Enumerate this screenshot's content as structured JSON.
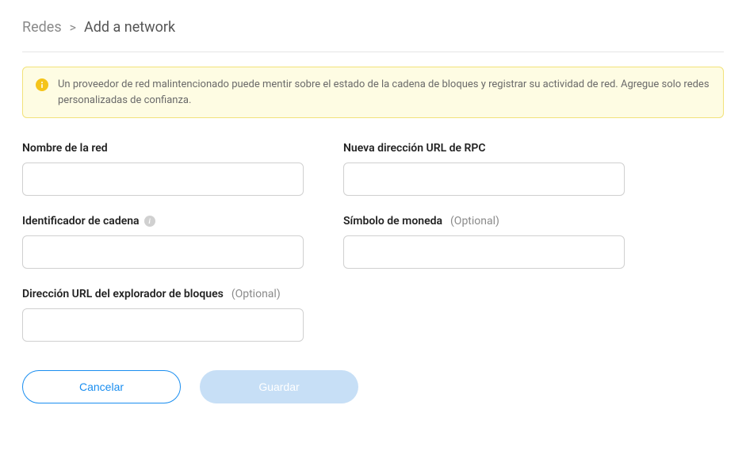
{
  "breadcrumb": {
    "root": "Redes",
    "current": "Add a network"
  },
  "warning": {
    "text": "Un proveedor de red malintencionado puede mentir sobre el estado de la cadena de bloques y registrar su actividad de red. Agregue solo redes personalizadas de confianza."
  },
  "fields": {
    "networkName": {
      "label": "Nombre de la red",
      "value": ""
    },
    "rpcUrl": {
      "label": "Nueva dirección URL de RPC",
      "value": ""
    },
    "chainId": {
      "label": "Identificador de cadena",
      "value": ""
    },
    "currencySymbol": {
      "label": "Símbolo de moneda",
      "optional": "(Optional)",
      "value": ""
    },
    "blockExplorer": {
      "label": "Dirección URL del explorador de bloques",
      "optional": "(Optional)",
      "value": ""
    }
  },
  "buttons": {
    "cancel": "Cancelar",
    "save": "Guardar"
  }
}
